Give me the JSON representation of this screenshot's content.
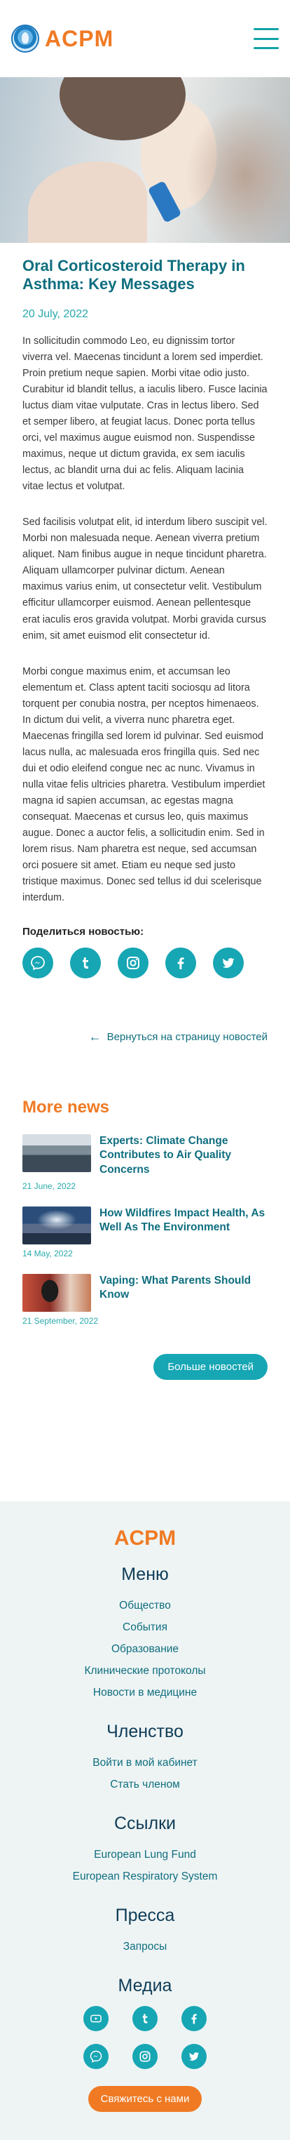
{
  "header": {
    "logo_text": "ACPM",
    "menu_icon": "hamburger-icon"
  },
  "colors": {
    "accent_orange": "#f07a24",
    "teal": "#16a6b4",
    "dark_teal": "#0f6e7f",
    "footer_bg": "#eef4f4"
  },
  "article": {
    "title": "Oral Corticosteroid Therapy in Asthma: Key Messages",
    "date": "20 July, 2022",
    "paragraphs": [
      "In sollicitudin commodo Leo, eu dignissim tortor viverra vel. Maecenas tincidunt a lorem sed imperdiet. Proin pretium neque sapien. Morbi vitae odio justo. Curabitur id blandit tellus, a iaculis libero. Fusce lacinia luctus diam vitae vulputate. Cras in lectus libero. Sed et semper libero, at feugiat lacus. Donec porta tellus orci, vel maximus augue euismod non. Suspendisse maximus, neque ut dictum gravida, ex sem iaculis lectus, ac blandit urna dui ac felis. Aliquam lacinia vitae lectus et volutpat.",
      "Sed facilisis volutpat elit, id interdum libero suscipit vel. Morbi non malesuada neque. Aenean viverra pretium aliquet. Nam finibus augue in neque tincidunt pharetra. Aliquam ullamcorper pulvinar dictum. Aenean maximus varius enim, ut consectetur velit. Vestibulum efficitur ullamcorper euismod. Aenean pellentesque erat iaculis eros gravida volutpat. Morbi gravida cursus enim, sit amet euismod elit consectetur id.",
      "Morbi congue maximus enim, et accumsan leo elementum et. Class aptent taciti sociosqu ad litora torquent per conubia nostra, per nceptos himenaeos. In dictum dui velit, a viverra nunc pharetra eget. Maecenas fringilla sed lorem id pulvinar. Sed euismod lacus nulla, ac malesuada eros fringilla quis. Sed nec dui et odio eleifend congue nec ac nunc. Vivamus in nulla vitae felis ultricies pharetra. Vestibulum imperdiet magna id sapien accumsan, ac egestas magna consequat. Maecenas et cursus leo, quis maximus augue. Donec a auctor felis, a sollicitudin enim. Sed in lorem risus. Nam pharetra est neque, sed accumsan orci posuere sit amet. Etiam eu neque sed justo tristique maximus. Donec sed tellus id dui scelerisque interdum."
    ],
    "share_label": "Поделиться новостью:",
    "share_icons": [
      "messenger-icon",
      "tumblr-icon",
      "instagram-icon",
      "facebook-icon",
      "twitter-icon"
    ],
    "back_label": "Вернуться на страницу новостей"
  },
  "more_news": {
    "title": "More news",
    "items": [
      {
        "title": "Experts: Climate Change Contributes to Air Quality Concerns",
        "date": "21 June, 2022"
      },
      {
        "title": "How Wildfires Impact Health, As Well As The Environment",
        "date": "14 May, 2022"
      },
      {
        "title": "Vaping: What Parents Should Know",
        "date": "21 September, 2022"
      }
    ],
    "button_label": "Больше новостей"
  },
  "footer": {
    "logo_text": "ACPM",
    "menu": {
      "heading": "Меню",
      "links": [
        "Общество",
        "События",
        "Образование",
        "Клинические протоколы",
        "Новости в медицине"
      ]
    },
    "membership": {
      "heading": "Членство",
      "links": [
        "Войти в мой кабинет",
        "Стать членом"
      ]
    },
    "links": {
      "heading": "Ссылки",
      "links": [
        "European Lung Fund",
        "European Respiratory System"
      ]
    },
    "press": {
      "heading": "Пресса",
      "links": [
        "Запросы"
      ]
    },
    "media": {
      "heading": "Медиа",
      "icons_row1": [
        "youtube-icon",
        "tumblr-icon",
        "facebook-icon"
      ],
      "icons_row2": [
        "messenger-icon",
        "instagram-icon",
        "twitter-icon"
      ]
    },
    "contact_label": "Свяжитесь с нами"
  }
}
